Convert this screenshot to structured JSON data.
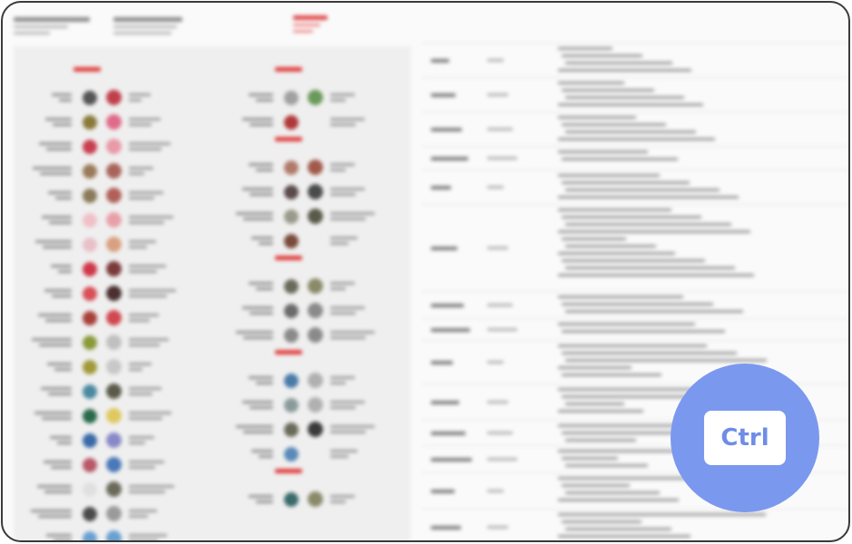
{
  "overlay": {
    "key_label": "Ctrl",
    "badge_color": "#7b98ef",
    "key_text_color": "#6f8de6"
  },
  "document": {
    "accent_color": "#e03c3c",
    "left_columns": [
      {
        "sections": [
          {
            "dots": [
              [
                "#555555",
                "#c0404a"
              ],
              [
                "#8a7a3a",
                "#e06a8a"
              ],
              [
                "#c84050",
                "#e89aa8"
              ],
              [
                "#9a7a5a",
                "#a8645a"
              ],
              [
                "#8a7a5a",
                "#b06058"
              ],
              [
                "#f0c0c8",
                "#e8a0a8"
              ],
              [
                "#e8c0c8",
                "#d8a080"
              ],
              [
                "#d03848",
                "#7a3a3a"
              ],
              [
                "#d85058",
                "#4a3030"
              ],
              [
                "#a8403a",
                "#d04850"
              ],
              [
                "#8a9a3a",
                "#c0c0c0"
              ],
              [
                "#a09a3a",
                "#c8c8c8"
              ],
              [
                "#4a8aa0",
                "#5a5a4a"
              ],
              [
                "#2a6a4a",
                "#e0c860"
              ],
              [
                "#3a6aa8",
                "#8888c8"
              ],
              [
                "#b85868",
                "#4a78b8"
              ],
              [
                "#e0e0e0",
                "#6a6a5a"
              ],
              [
                "#4a4a4a",
                "#9a9a9a"
              ],
              [
                "#6aa0d0",
                "#6aa0d0"
              ]
            ]
          }
        ]
      },
      {
        "sections": [
          {
            "dots": [
              [
                "#a0a0a0",
                "#6a9a5a"
              ],
              [
                "#b03838",
                "#efefef"
              ]
            ]
          },
          {
            "dots": [
              [
                "#b07a6a",
                "#a05a4a"
              ],
              [
                "#5a4a4a",
                "#4a4a4a"
              ],
              [
                "#9a9a8a",
                "#5a5a4a"
              ],
              [
                "#7a4a3a",
                "#efefef"
              ]
            ]
          },
          {
            "dots": [
              [
                "#6a6a5a",
                "#8a8a6a"
              ],
              [
                "#6a6a6a",
                "#8a8a8a"
              ],
              [
                "#8a8a8a",
                "#8a8a8a"
              ]
            ]
          },
          {
            "dots": [
              [
                "#4a7aa8",
                "#b0b0b0"
              ],
              [
                "#8a9a9a",
                "#b0b0b0"
              ],
              [
                "#6a6a5a",
                "#3a3a3a"
              ],
              [
                "#5a8ab8",
                "#efefef"
              ]
            ]
          },
          {
            "dots": [
              [
                "#3a6a6a",
                "#8a8a6a"
              ]
            ]
          }
        ]
      }
    ]
  }
}
